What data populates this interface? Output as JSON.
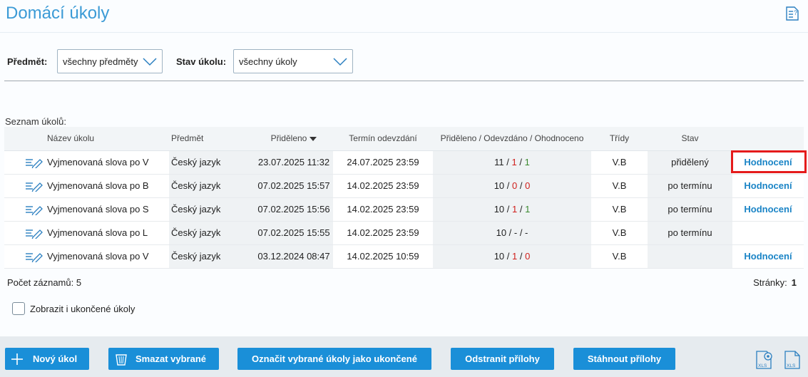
{
  "header": {
    "title": "Domácí úkoly",
    "help_icon": "help-document-icon"
  },
  "filters": {
    "subject_label": "Předmět:",
    "subject_value": "všechny předměty",
    "status_label": "Stav úkolu:",
    "status_value": "všechny úkoly"
  },
  "list": {
    "label": "Seznam úkolů:",
    "columns": [
      "Název úkolu",
      "Předmět",
      "Přiděleno",
      "Termín odevzdání",
      "Přiděleno / Odevzdáno / Ohodnoceno",
      "Třídy",
      "Stav"
    ],
    "rows": [
      {
        "name": "Vyjmenovaná slova po V",
        "subject": "Český jazyk",
        "assigned": "23.07.2025 11:32",
        "due": "24.07.2025 23:59",
        "c1": "11",
        "c2": "1",
        "c3": "1",
        "classes": "V.B",
        "status": "přidělený",
        "link": "Hodnocení"
      },
      {
        "name": "Vyjmenovaná slova po B",
        "subject": "Český jazyk",
        "assigned": "07.02.2025 15:57",
        "due": "14.02.2025 23:59",
        "c1": "10",
        "c2": "0",
        "c3": "0",
        "classes": "V.B",
        "status": "po termínu",
        "link": "Hodnocení"
      },
      {
        "name": "Vyjmenovaná slova po S",
        "subject": "Český jazyk",
        "assigned": "07.02.2025 15:56",
        "due": "14.02.2025 23:59",
        "c1": "10",
        "c2": "1",
        "c3": "1",
        "classes": "V.B",
        "status": "po termínu",
        "link": "Hodnocení"
      },
      {
        "name": "Vyjmenovaná slova po L",
        "subject": "Český jazyk",
        "assigned": "07.02.2025 15:55",
        "due": "14.02.2025 23:59",
        "counts": "10 / - / -",
        "classes": "V.B",
        "status": "po termínu",
        "link": ""
      },
      {
        "name": "Vyjmenovaná slova po V",
        "subject": "Český jazyk",
        "assigned": "03.12.2024 08:47",
        "due": "14.02.2025 10:59",
        "c1": "10",
        "c2": "1",
        "c3": "0",
        "classes": "V.B",
        "status": "",
        "link": "Hodnocení"
      }
    ],
    "record_count": "Počet záznamů: 5",
    "pages_label": "Stránky:",
    "pages_value": "1"
  },
  "show_finished_label": "Zobrazit i ukončené úkoly",
  "footer": {
    "new_task": "Nový úkol",
    "delete_selected": "Smazat vybrané",
    "mark_finished": "Označit vybrané úkoly jako ukončené",
    "remove_attachments": "Odstranit přílohy",
    "download_attachments": "Stáhnout přílohy",
    "xls_label": "XLS"
  },
  "colors": {
    "accent": "#1a8fd8",
    "title": "#3c9bd6",
    "red": "#d0201c",
    "green": "#3a8a2e",
    "highlight": "#e51b1b"
  }
}
